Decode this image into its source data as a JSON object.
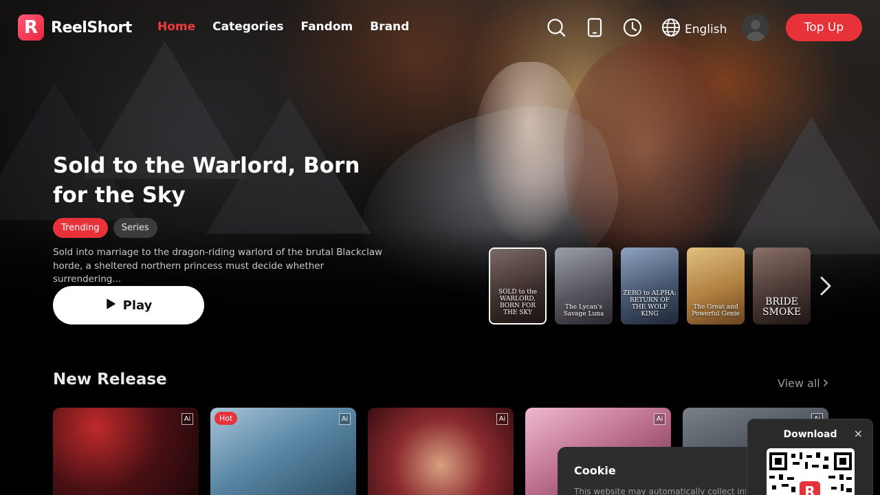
{
  "brand": {
    "name": "ReelShort",
    "logo_letter": "R"
  },
  "nav": {
    "items": [
      {
        "label": "Home",
        "active": true
      },
      {
        "label": "Categories",
        "active": false
      },
      {
        "label": "Fandom",
        "active": false
      },
      {
        "label": "Brand",
        "active": false
      }
    ]
  },
  "header": {
    "icons": [
      "search-icon",
      "mobile-app-icon",
      "history-icon",
      "globe-icon"
    ],
    "language": "English",
    "topup_label": "Top Up"
  },
  "hero": {
    "title": "Sold to the Warlord, Born for the Sky",
    "tags": [
      "Trending",
      "Series"
    ],
    "description": "Sold into marriage to the dragon-riding warlord of the brutal Blackclaw horde, a sheltered northern princess must decide whether surrendering...",
    "play_label": "Play"
  },
  "thumbnails": [
    {
      "title": "SOLD to the WARLORD, BORN FOR THE SKY",
      "selected": true,
      "color": "#5b4a45"
    },
    {
      "title": "The Lycan's Savage Luna",
      "selected": false,
      "color": "#6b6a72"
    },
    {
      "title": "ZERO to ALPHA: RETURN OF THE WOLF KING",
      "selected": false,
      "color": "#4c5a6e"
    },
    {
      "title": "The Great and Powerful Genie",
      "selected": false,
      "color": "#b08a4a"
    },
    {
      "title": "BRIDE SMOKE",
      "selected": false,
      "color": "#4a3a38"
    }
  ],
  "new_release": {
    "title": "New Release",
    "view_all": "View all",
    "cards": [
      {
        "badge": "Ai",
        "hot": "",
        "color": "#6a1f22"
      },
      {
        "badge": "Ai",
        "hot": "Hot",
        "color": "#4a7fa0"
      },
      {
        "badge": "Ai",
        "hot": "",
        "color": "#8a2a2e"
      },
      {
        "badge": "Ai",
        "hot": "",
        "color": "#b86a8a"
      },
      {
        "badge": "Ai",
        "hot": "",
        "color": "#4a5058"
      }
    ]
  },
  "cookie": {
    "title": "Cookie",
    "text": "This website may automatically collect information"
  },
  "download": {
    "title": "Download",
    "close": "×"
  },
  "colors": {
    "accent": "#e8323a",
    "active_nav": "#ef3b3b"
  }
}
